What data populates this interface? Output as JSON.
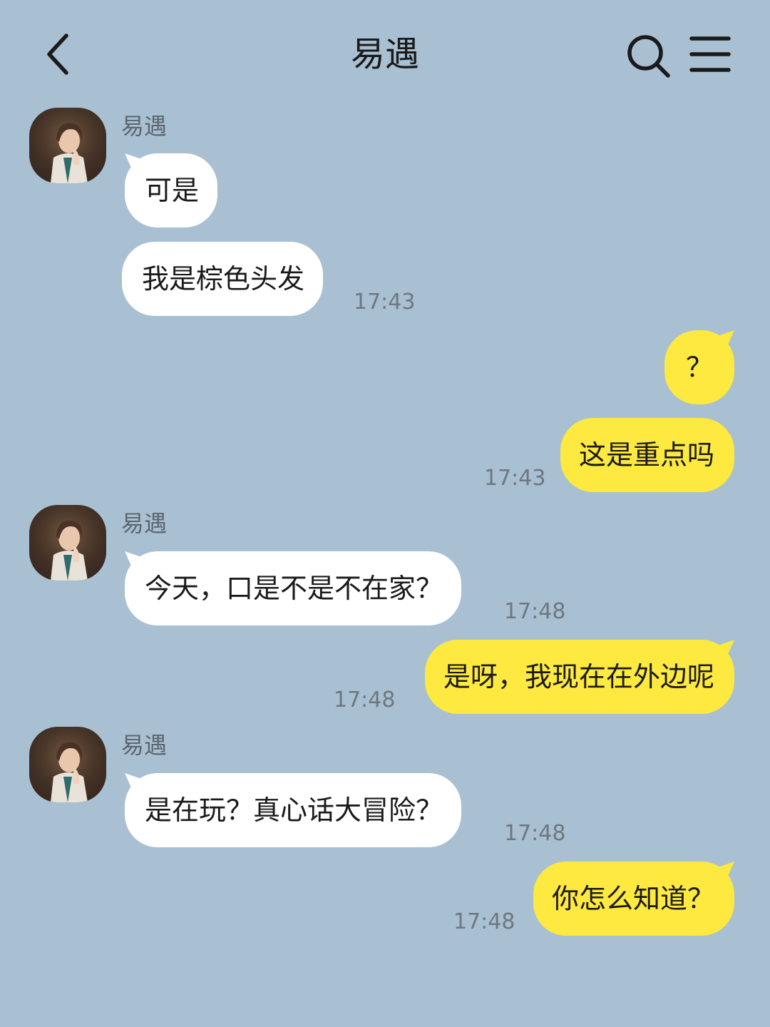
{
  "header": {
    "title": "易遇",
    "back_icon": "chevron-left-icon",
    "search_icon": "search-icon",
    "menu_icon": "menu-icon"
  },
  "colors": {
    "background": "#A9C0D2",
    "incoming_bubble": "#FFFFFF",
    "outgoing_bubble": "#FDE93F"
  },
  "messages": [
    {
      "sender": "易遇",
      "direction": "incoming",
      "bubbles": [
        "可是",
        "我是棕色头发"
      ],
      "time": "17:43"
    },
    {
      "direction": "outgoing",
      "bubbles": [
        "？",
        "这是重点吗"
      ],
      "time": "17:43"
    },
    {
      "sender": "易遇",
      "direction": "incoming",
      "bubbles": [
        "今天，口是不是不在家？"
      ],
      "time": "17:48"
    },
    {
      "direction": "outgoing",
      "bubbles": [
        "是呀，我现在在外边呢"
      ],
      "time": "17:48"
    },
    {
      "sender": "易遇",
      "direction": "incoming",
      "bubbles": [
        "是在玩？真心话大冒险？"
      ],
      "time": "17:48"
    },
    {
      "direction": "outgoing",
      "bubbles": [
        "你怎么知道？"
      ],
      "time": "17:48"
    }
  ]
}
